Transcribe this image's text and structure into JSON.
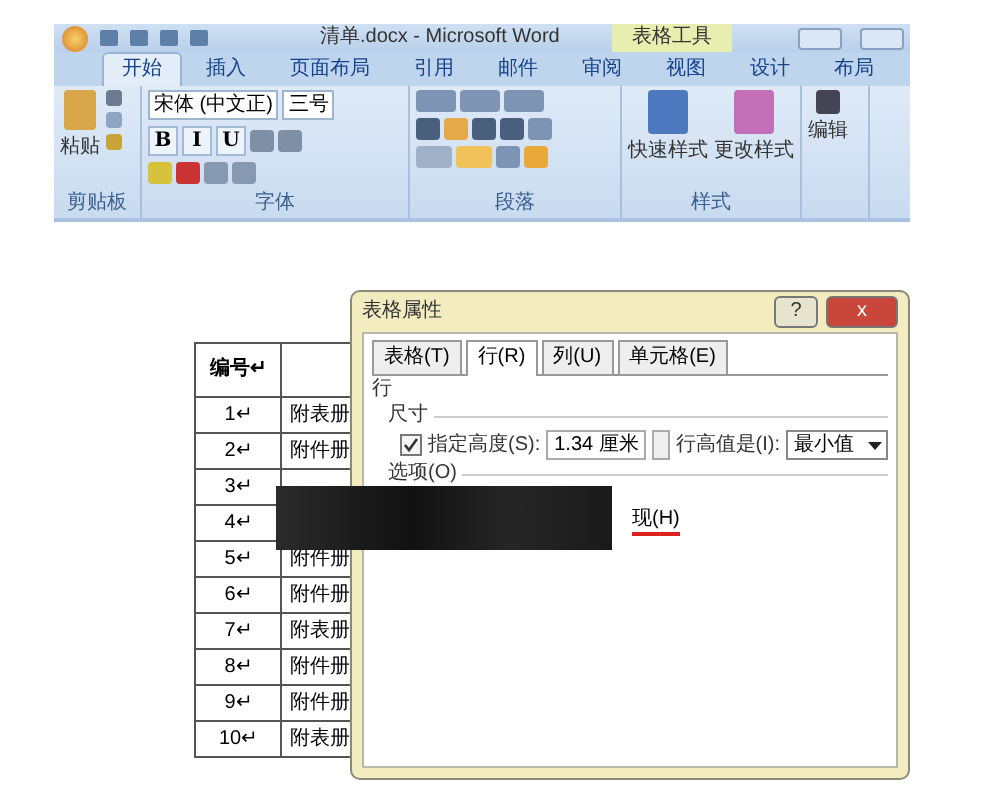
{
  "title_bar": {
    "title": "清单.docx - Microsoft Word",
    "context": "表格工具"
  },
  "ribbon_tabs": [
    {
      "label": "开始",
      "selected": true
    },
    {
      "label": "插入",
      "selected": false
    },
    {
      "label": "页面布局",
      "selected": false
    },
    {
      "label": "引用",
      "selected": false
    },
    {
      "label": "邮件",
      "selected": false
    },
    {
      "label": "审阅",
      "selected": false
    },
    {
      "label": "视图",
      "selected": false
    },
    {
      "label": "设计",
      "selected": false
    },
    {
      "label": "布局",
      "selected": false
    }
  ],
  "clipboard": {
    "paste": "粘贴",
    "label": "剪贴板"
  },
  "font": {
    "face": "宋体 (中文正)",
    "size": "三号",
    "format_buttons": [
      "B",
      "I",
      "U"
    ],
    "label": "字体"
  },
  "paragraph": {
    "label": "段落"
  },
  "styles": {
    "items": [
      "快速样式",
      "更改样式"
    ],
    "label": "样式"
  },
  "editing": {
    "label": "编辑"
  },
  "table": {
    "header": "编号↵",
    "rows": [
      {
        "number": "1↵",
        "name": "附表册"
      },
      {
        "number": "2↵",
        "name": "附件册"
      },
      {
        "number": "3↵"
      },
      {
        "number": "4↵"
      },
      {
        "number": "5↵",
        "name": "附件册"
      },
      {
        "number": "6↵",
        "name": "附件册"
      },
      {
        "number": "7↵",
        "name": "附表册"
      },
      {
        "number": "8↵",
        "name": "附件册"
      },
      {
        "number": "9↵",
        "name": "附件册"
      },
      {
        "number": "10↵",
        "name": "附表册"
      }
    ]
  },
  "dialog": {
    "title": "表格属性",
    "help": "?",
    "close": "x",
    "tabs": [
      {
        "label": "表格(T)",
        "selected": false
      },
      {
        "label": "行(R)",
        "selected": true
      },
      {
        "label": "列(U)",
        "selected": false
      },
      {
        "label": "单元格(E)",
        "selected": false
      }
    ],
    "section": "行",
    "size_label": "尺寸",
    "height_check": {
      "label": "指定高度(S):",
      "checked": true
    },
    "height_value": "1.34 厘米",
    "rule_label": "行高值是(I):",
    "rule_value": "最小值",
    "options_label": "选项(O)",
    "partial_option": "现(H)"
  }
}
